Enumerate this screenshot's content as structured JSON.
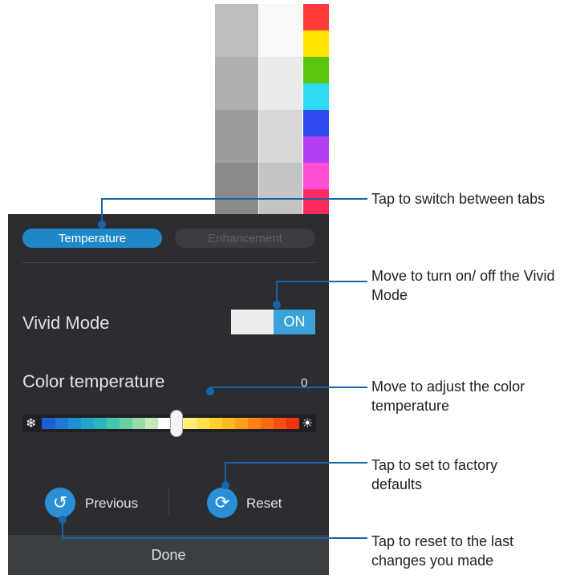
{
  "tabs": [
    {
      "label": "Temperature",
      "active": true
    },
    {
      "label": "Enhancement",
      "active": false
    }
  ],
  "vivid_mode": {
    "label": "Vivid Mode",
    "toggle_label": "ON"
  },
  "color_temperature": {
    "label": "Color temperature",
    "value": "0"
  },
  "actions": {
    "previous": "Previous",
    "reset": "Reset",
    "done": "Done"
  },
  "icons": {
    "slider_start": "snowflake-icon",
    "slider_end": "sun-icon",
    "previous": "undo-icon",
    "reset": "refresh-icon"
  },
  "callouts": [
    {
      "text": "Tap to switch between tabs"
    },
    {
      "text": "Move to turn on/ off the Vivid Mode"
    },
    {
      "text": "Move to adjust the color temperature"
    },
    {
      "text": "Tap to set to factory defaults"
    },
    {
      "text": "Tap to reset to the last changes you made"
    }
  ],
  "colors": {
    "accent": "#1e88c8",
    "callout_line": "#1565a8",
    "panel": "#2b2d31",
    "swatches": [
      "#ff3b3b",
      "#ffe400",
      "#5ac40f",
      "#31dcf2",
      "#2e4cf0",
      "#b040f2",
      "#ff4fd8",
      "#ff2b5e"
    ],
    "gray_col1": [
      "#bdbdbd",
      "#afafaf",
      "#9c9c9c",
      "#8a8a8a"
    ],
    "gray_col2": [
      "#f9f9f9",
      "#ebebeb",
      "#d8d8d8",
      "#c4c4c4"
    ],
    "gradient": [
      "#1a5fd6",
      "#1c79d4",
      "#1d90cf",
      "#22a5c8",
      "#2cb6bb",
      "#48c4ad",
      "#6ccfa1",
      "#98dba6",
      "#c4e8b8",
      "#ffffff",
      "#fff7b0",
      "#ffef7a",
      "#ffe14a",
      "#ffd02a",
      "#ffba20",
      "#ffa01a",
      "#ff8414",
      "#ff6a12",
      "#ff4e10",
      "#f4320e"
    ]
  }
}
